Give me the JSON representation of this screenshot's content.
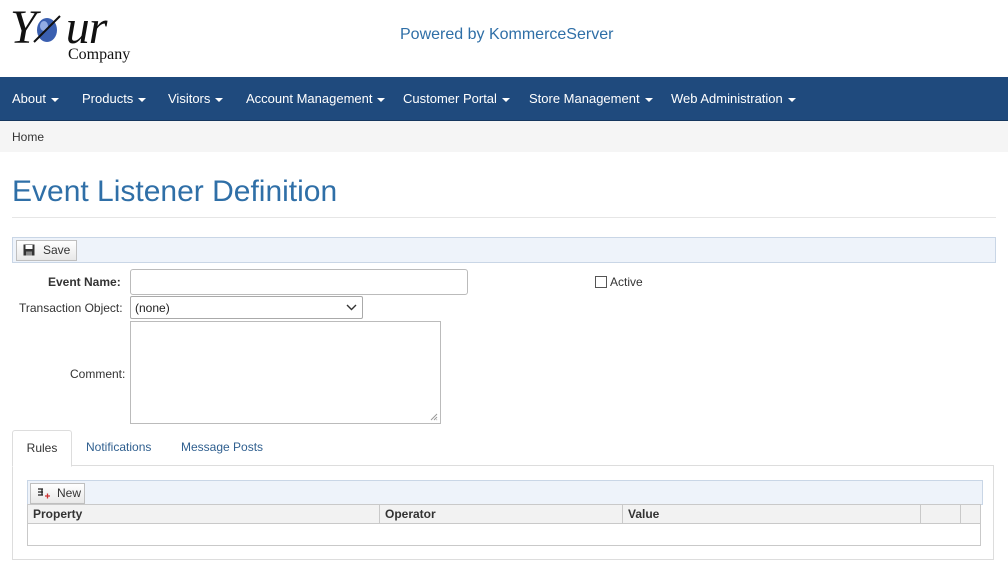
{
  "header": {
    "logo_text_big": "Your",
    "logo_text_small": "Company",
    "powered_by": "Powered by KommerceServer"
  },
  "nav": {
    "items": [
      {
        "label": "About"
      },
      {
        "label": "Products"
      },
      {
        "label": "Visitors"
      },
      {
        "label": "Account Management"
      },
      {
        "label": "Customer Portal"
      },
      {
        "label": "Store Management"
      },
      {
        "label": "Web Administration"
      }
    ]
  },
  "breadcrumb": {
    "home": "Home"
  },
  "page": {
    "title": "Event Listener Definition"
  },
  "toolbar": {
    "save_label": "Save"
  },
  "form": {
    "event_name_label": "Event Name:",
    "event_name_value": "",
    "transaction_object_label": "Transaction Object:",
    "transaction_object_value": "(none)",
    "comment_label": "Comment:",
    "comment_value": "",
    "active_label": "Active",
    "active_checked": false
  },
  "tabs": [
    {
      "label": "Rules",
      "active": true
    },
    {
      "label": "Notifications",
      "active": false
    },
    {
      "label": "Message Posts",
      "active": false
    }
  ],
  "rules_grid": {
    "new_label": "New",
    "columns": [
      "Property",
      "Operator",
      "Value"
    ]
  },
  "colors": {
    "navbar": "#1f4a7d",
    "title": "#2f6fa7",
    "toolbar_bg": "#eef3fa"
  },
  "icons": [
    "caret-down-icon",
    "save-icon",
    "chevron-down-icon",
    "new-rule-icon",
    "resize-grip-icon"
  ]
}
